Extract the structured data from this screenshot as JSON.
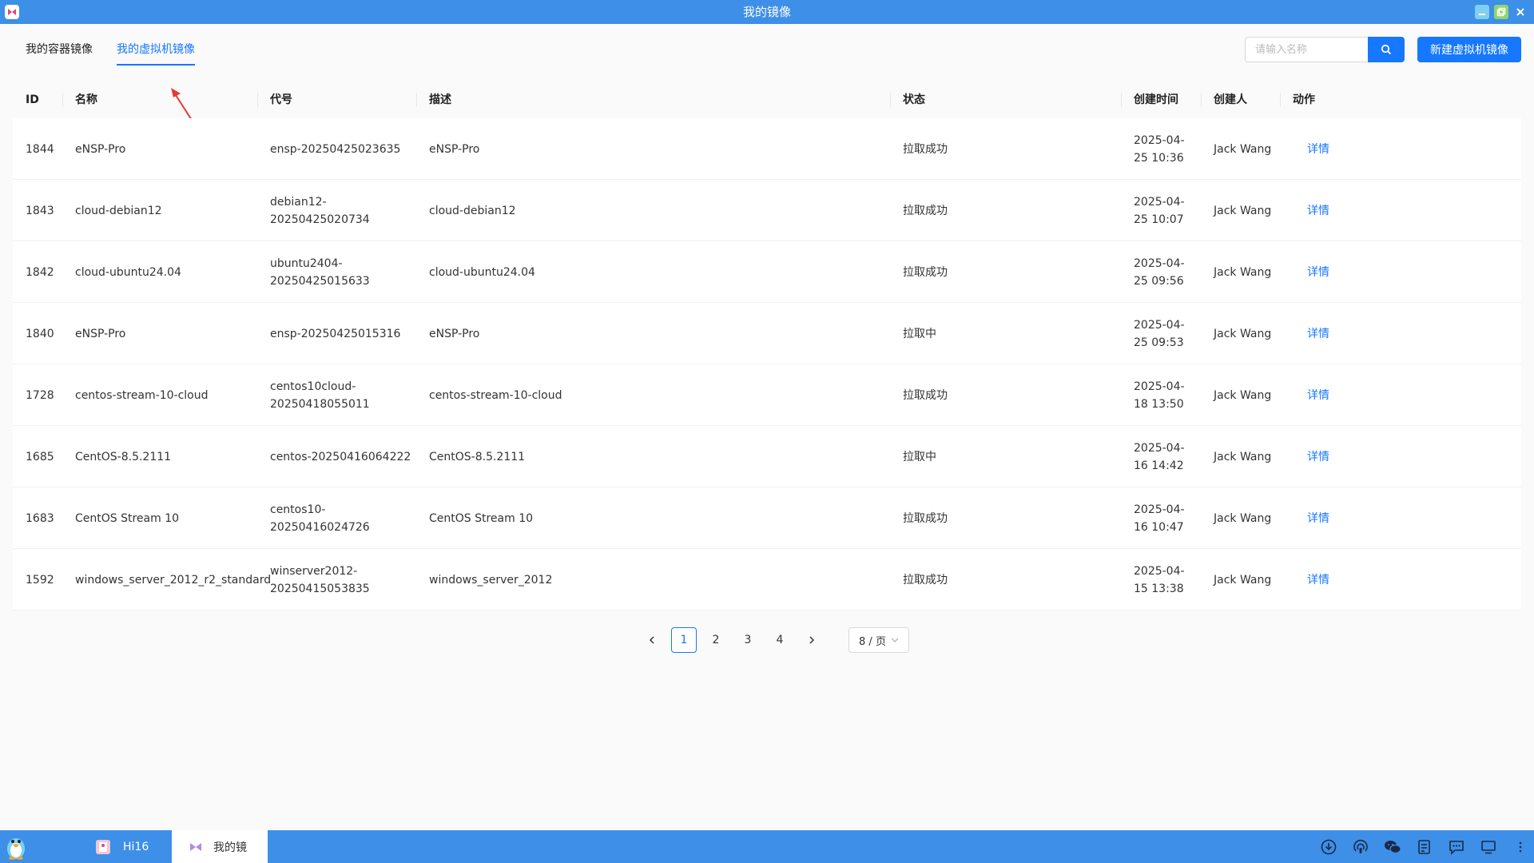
{
  "window": {
    "title": "我的镜像"
  },
  "tabs": [
    {
      "label": "我的容器镜像",
      "active": false
    },
    {
      "label": "我的虚拟机镜像",
      "active": true
    }
  ],
  "search": {
    "placeholder": "请输入名称",
    "value": ""
  },
  "actions": {
    "new_button": "新建虚拟机镜像"
  },
  "table": {
    "headers": [
      "ID",
      "名称",
      "代号",
      "描述",
      "状态",
      "创建时间",
      "创建人",
      "动作"
    ],
    "rows": [
      {
        "id": "1844",
        "name": "eNSP-Pro",
        "code": [
          "ensp-20250425023635"
        ],
        "desc": "eNSP-Pro",
        "status": "拉取成功",
        "time": [
          "2025-04-",
          "25 10:36"
        ],
        "creator": "Jack Wang",
        "action": "详情"
      },
      {
        "id": "1843",
        "name": "cloud-debian12",
        "code": [
          "debian12-",
          "20250425020734"
        ],
        "desc": "cloud-debian12",
        "status": "拉取成功",
        "time": [
          "2025-04-",
          "25 10:07"
        ],
        "creator": "Jack Wang",
        "action": "详情"
      },
      {
        "id": "1842",
        "name": "cloud-ubuntu24.04",
        "code": [
          "ubuntu2404-",
          "20250425015633"
        ],
        "desc": "cloud-ubuntu24.04",
        "status": "拉取成功",
        "time": [
          "2025-04-",
          "25 09:56"
        ],
        "creator": "Jack Wang",
        "action": "详情"
      },
      {
        "id": "1840",
        "name": "eNSP-Pro",
        "code": [
          "ensp-20250425015316"
        ],
        "desc": "eNSP-Pro",
        "status": "拉取中",
        "time": [
          "2025-04-",
          "25 09:53"
        ],
        "creator": "Jack Wang",
        "action": "详情"
      },
      {
        "id": "1728",
        "name": "centos-stream-10-cloud",
        "code": [
          "centos10cloud-",
          "20250418055011"
        ],
        "desc": "centos-stream-10-cloud",
        "status": "拉取成功",
        "time": [
          "2025-04-",
          "18 13:50"
        ],
        "creator": "Jack Wang",
        "action": "详情"
      },
      {
        "id": "1685",
        "name": "CentOS-8.5.2111",
        "code": [
          "centos-20250416064222"
        ],
        "desc": "CentOS-8.5.2111",
        "status": "拉取中",
        "time": [
          "2025-04-",
          "16 14:42"
        ],
        "creator": "Jack Wang",
        "action": "详情"
      },
      {
        "id": "1683",
        "name": "CentOS Stream 10",
        "code": [
          "centos10-20250416024726"
        ],
        "desc": "CentOS Stream 10",
        "status": "拉取成功",
        "time": [
          "2025-04-",
          "16 10:47"
        ],
        "creator": "Jack Wang",
        "action": "详情"
      },
      {
        "id": "1592",
        "name": "windows_server_2012_r2_standard",
        "code": [
          "winserver2012-",
          "20250415053835"
        ],
        "desc": "windows_server_2012",
        "status": "拉取成功",
        "time": [
          "2025-04-",
          "15 13:38"
        ],
        "creator": "Jack Wang",
        "action": "详情"
      }
    ]
  },
  "pagination": {
    "prev": "<",
    "next": ">",
    "pages": [
      "1",
      "2",
      "3",
      "4"
    ],
    "current": "1",
    "page_size": "8 / 页"
  },
  "taskbar": {
    "items": [
      {
        "label": "Hi16",
        "active": false
      },
      {
        "label": "我的镜",
        "active": true
      }
    ],
    "tray_icons": [
      "download-icon",
      "podcast-icon",
      "wechat-icon",
      "notes-icon",
      "chat-icon",
      "display-icon",
      "more-icon"
    ]
  },
  "colors": {
    "accent": "#1677ff",
    "titlebar": "#3d8fe8",
    "annotation_arrow": "#e53935"
  }
}
